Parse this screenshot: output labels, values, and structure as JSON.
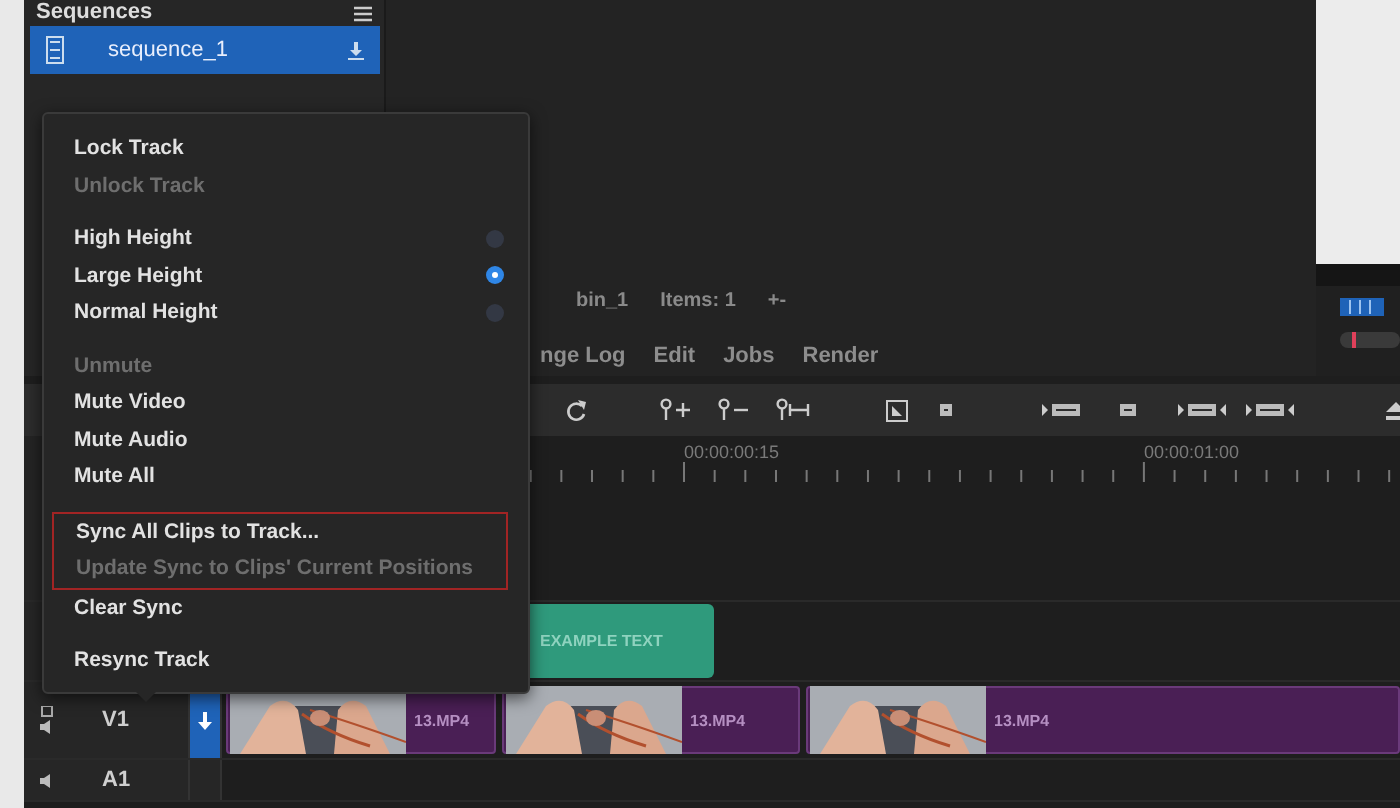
{
  "sequences_panel": {
    "title": "Sequences",
    "items": [
      {
        "name": "sequence_1",
        "selected": true
      }
    ]
  },
  "bin_bar": {
    "name": "bin_1",
    "count": "Items: 1",
    "zoom": "+-"
  },
  "tabs": [
    {
      "label": "nge Log"
    },
    {
      "label": "Edit"
    },
    {
      "label": "Jobs"
    },
    {
      "label": "Render"
    }
  ],
  "ruler": {
    "labels": [
      "00:00:00:15",
      "00:00:01:00"
    ]
  },
  "tracks": [
    {
      "kind": "empty"
    },
    {
      "kind": "title",
      "clips": [
        {
          "label": "EXAMPLE TEXT"
        }
      ]
    },
    {
      "kind": "video",
      "name": "V1",
      "sync": true,
      "clips": [
        {
          "label": "13.MP4"
        },
        {
          "label": "13.MP4"
        },
        {
          "label": "13.MP4"
        }
      ]
    },
    {
      "kind": "audio",
      "name": "A1",
      "sync": false
    }
  ],
  "preview": {
    "volume": {
      "level": 0.2
    }
  },
  "context_menu": {
    "sections": [
      {
        "items": [
          {
            "kind": "action",
            "label": "Lock Track",
            "disabled": false,
            "highlighted": false
          },
          {
            "kind": "action",
            "label": "Unlock Track",
            "disabled": true,
            "highlighted": false
          }
        ]
      },
      {
        "items": [
          {
            "kind": "radio",
            "label": "High Height",
            "disabled": false,
            "selected": false,
            "highlighted": false
          },
          {
            "kind": "radio",
            "label": "Large Height",
            "disabled": false,
            "selected": true,
            "highlighted": false
          },
          {
            "kind": "radio",
            "label": "Normal Height",
            "disabled": false,
            "selected": false,
            "highlighted": false
          }
        ]
      },
      {
        "items": [
          {
            "kind": "action",
            "label": "Unmute",
            "disabled": true,
            "highlighted": false
          },
          {
            "kind": "action",
            "label": "Mute Video",
            "disabled": false,
            "highlighted": false
          },
          {
            "kind": "action",
            "label": "Mute Audio",
            "disabled": false,
            "highlighted": false
          },
          {
            "kind": "action",
            "label": "Mute All",
            "disabled": false,
            "highlighted": false
          }
        ]
      },
      {
        "items": [
          {
            "kind": "action",
            "label": "Sync All Clips to Track...",
            "disabled": false,
            "highlighted": true
          },
          {
            "kind": "action",
            "label": "Update Sync to Clips' Current Positions",
            "disabled": true,
            "highlighted": true
          },
          {
            "kind": "action",
            "label": "Clear Sync",
            "disabled": false,
            "highlighted": false
          }
        ]
      },
      {
        "items": [
          {
            "kind": "action",
            "label": "Resync Track",
            "disabled": false,
            "highlighted": false
          }
        ]
      }
    ]
  }
}
